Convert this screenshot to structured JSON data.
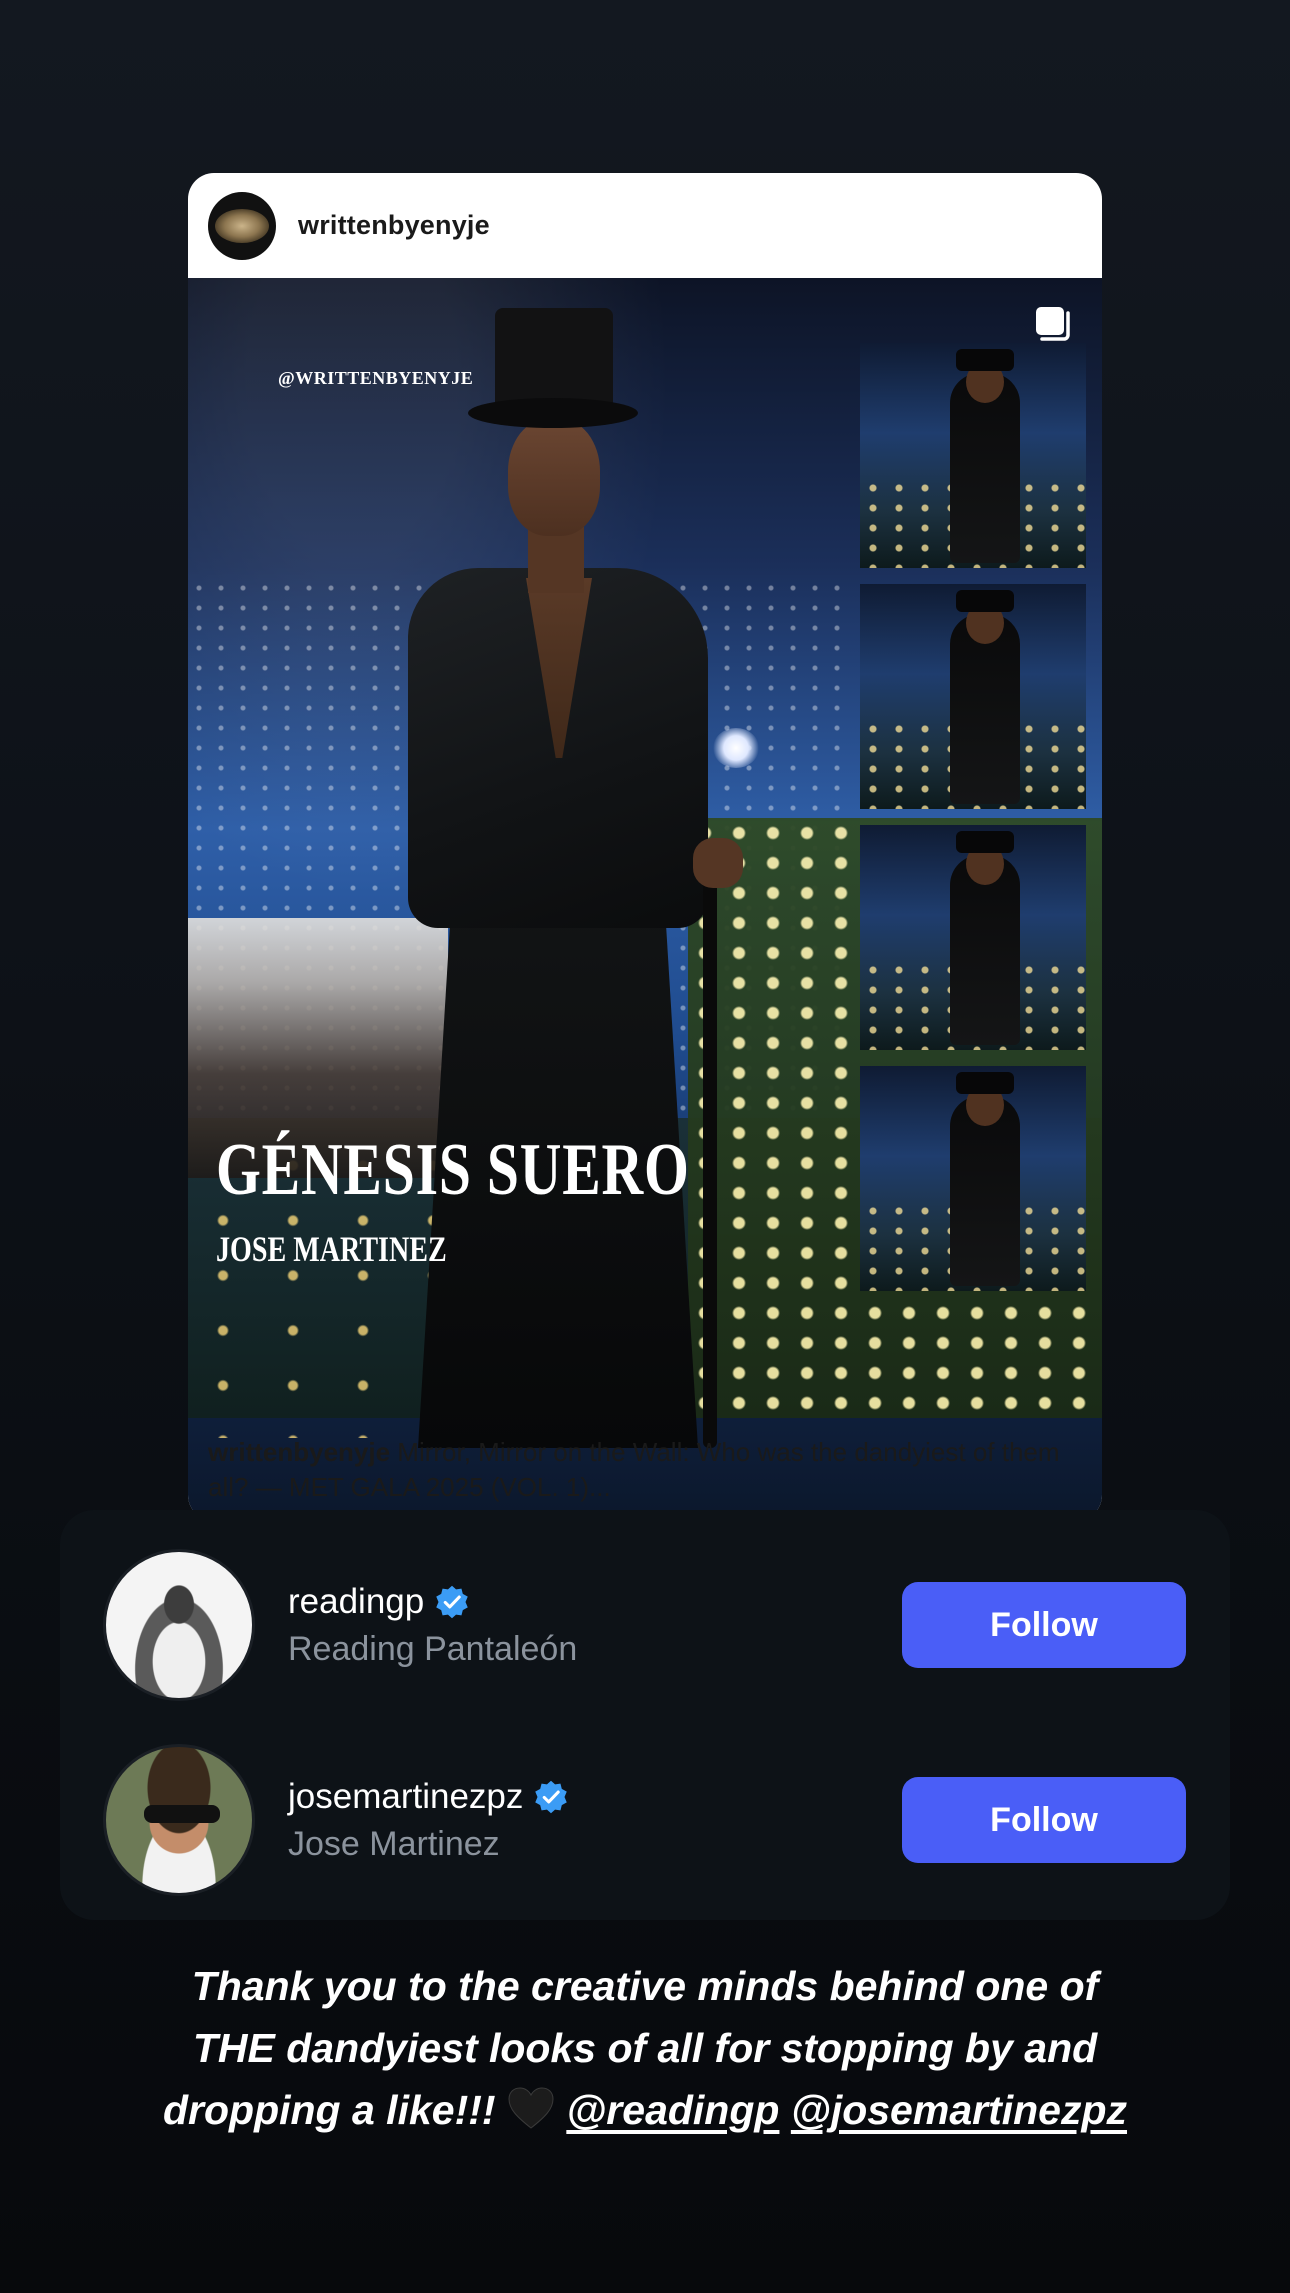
{
  "post": {
    "username": "writtenbyenyje",
    "watermark": "@WRITTENBYENYJE",
    "title": "GÉNESIS SUERO",
    "subtitle": "JOSE MARTINEZ",
    "caption_user": "writtenbyenyje",
    "caption_text": " Mirror, Mirror on the Wall: Who was the dandyiest of them all? — MET GALA 2025 (VOL. 1)...",
    "multi_icon": "carousel-icon"
  },
  "accounts": [
    {
      "handle": "readingp",
      "name": "Reading Pantaleón",
      "verified": true,
      "follow_label": "Follow"
    },
    {
      "handle": "josemartinezpz",
      "name": "Jose Martinez",
      "verified": true,
      "follow_label": "Follow"
    }
  ],
  "story_caption": {
    "text_line1": "Thank you to the creative minds behind one of",
    "text_line2": "THE dandyiest looks of all for stopping by and",
    "text_line3": "dropping a like!!! ",
    "heart": "black-heart-emoji",
    "mention1": "@readingp",
    "mention2": "@josemartinezpz"
  },
  "colors": {
    "follow_button": "#4a5ef7",
    "verified_badge": "#3b9cf5",
    "background": "#0d1117"
  }
}
